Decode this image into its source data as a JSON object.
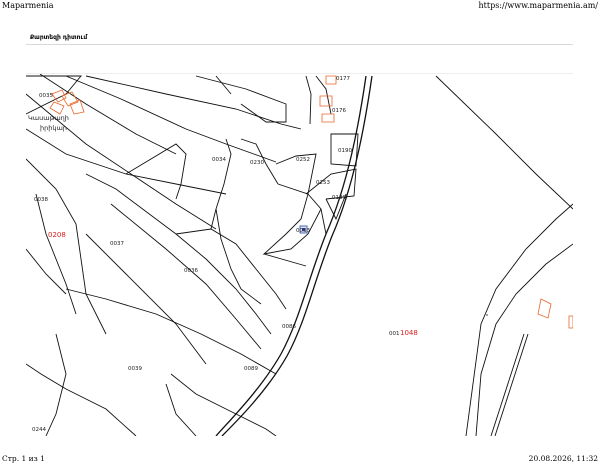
{
  "header": {
    "site_name": "Maparmenia",
    "url": "https://www.maparmenia.am/"
  },
  "footer": {
    "page": "Стр. 1 из 1",
    "datetime": "20.08.2026, 11:32"
  },
  "map": {
    "title": "Քարտեզի դիտում",
    "place_name_line1": "Կասաթաղի",
    "place_name_line2": "իրիկար",
    "parcels": [
      {
        "id": "0035",
        "color": "#222222"
      },
      {
        "id": "0177",
        "color": "#222222"
      },
      {
        "id": "0176",
        "color": "#222222"
      },
      {
        "id": "0034",
        "color": "#222222"
      },
      {
        "id": "0230",
        "color": "#222222"
      },
      {
        "id": "0252",
        "color": "#222222"
      },
      {
        "id": "0190",
        "color": "#222222"
      },
      {
        "id": "0253",
        "color": "#222222"
      },
      {
        "id": "0189",
        "color": "#222222"
      },
      {
        "id": "0038",
        "color": "#222222"
      },
      {
        "id": "0208",
        "color": "#d6201c"
      },
      {
        "id": "0037",
        "color": "#222222"
      },
      {
        "id": "0036",
        "color": "#222222"
      },
      {
        "id": "0033",
        "color": "#222222"
      },
      {
        "id": "0086",
        "color": "#222222"
      },
      {
        "id": "0039",
        "color": "#222222"
      },
      {
        "id": "0089",
        "color": "#222222"
      },
      {
        "id": "0244",
        "color": "#222222"
      }
    ],
    "large_parcel_prefix": "001",
    "large_parcel_suffix": "1048",
    "marker_icon": "building-marker-icon"
  }
}
